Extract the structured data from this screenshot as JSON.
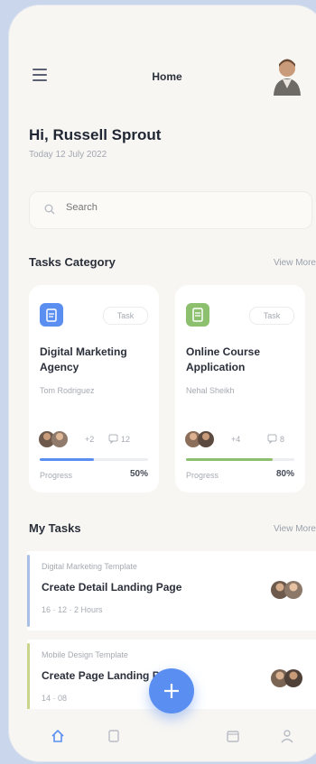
{
  "header": {
    "title": "Home"
  },
  "greeting": {
    "text": "Hi, Russell Sprout",
    "date": "Today 12 July 2022"
  },
  "search": {
    "placeholder": "Search"
  },
  "categories": {
    "title": "Tasks Category",
    "view_more": "View More",
    "cards": [
      {
        "title": "Digital Marketing Agency",
        "subtitle": "Tom Rodriguez",
        "badge": "Task",
        "members_extra": "+2",
        "comments": "12",
        "progress_label": "Progress",
        "progress_value": "50%",
        "progress": 0.5,
        "accent": "#5a8ff1"
      },
      {
        "title": "Online Course Application",
        "subtitle": "Nehal Sheikh",
        "badge": "Task",
        "members_extra": "+4",
        "comments": "8",
        "progress_label": "Progress",
        "progress_value": "80%",
        "progress": 0.8,
        "accent": "#8cc06e"
      }
    ]
  },
  "my_tasks": {
    "title": "My Tasks",
    "view_more": "View More",
    "items": [
      {
        "project": "Digital Marketing Template",
        "title": "Create Detail Landing Page",
        "meta": "16   ·   12   ·   2 Hours",
        "accent": "#a8bfe6"
      },
      {
        "project": "Mobile Design Template",
        "title": "Create Page Landing Page",
        "meta": "14   ·   08",
        "accent": "#c9d58a"
      }
    ]
  },
  "colors": {
    "primary": "#5a8ff1",
    "green": "#8cc06e",
    "background": "#f7f6f3"
  }
}
